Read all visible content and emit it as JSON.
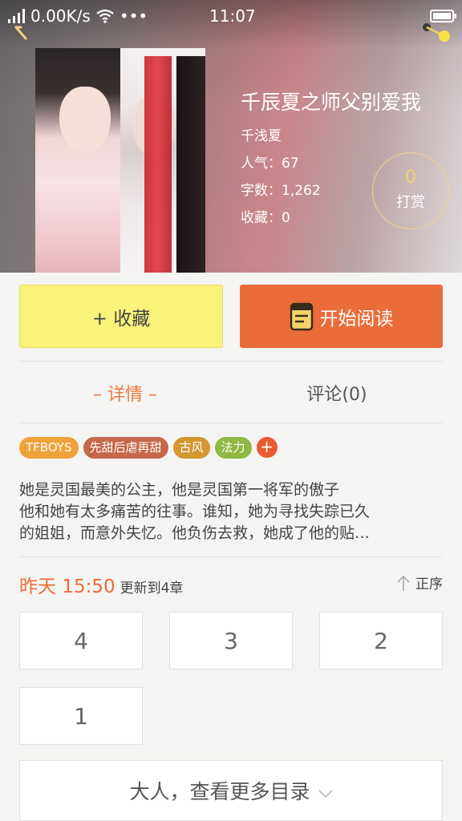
{
  "status_bar": {
    "network_speed": "0.00K/s",
    "more": "•••",
    "time": "11:07"
  },
  "book": {
    "title": "千辰夏之师父别爱我",
    "author": "千浅夏",
    "popularity_label": "人气：",
    "popularity": "67",
    "word_count_label": "字数：",
    "word_count": "1,262",
    "favorites_label": "收藏：",
    "favorites": "0"
  },
  "reward": {
    "count": "0",
    "label": "打赏"
  },
  "actions": {
    "collect_label": "+ 收藏",
    "read_label": "开始阅读"
  },
  "tabs": [
    {
      "label": "– 详情 –",
      "active": true
    },
    {
      "label": "评论(0)",
      "active": false
    }
  ],
  "tags": [
    {
      "label": "TFBOYS",
      "color": "#f0a23a"
    },
    {
      "label": "先甜后虐再甜",
      "color": "#c5674a"
    },
    {
      "label": "古风",
      "color": "#d4962f"
    },
    {
      "label": "法力",
      "color": "#8fb844"
    }
  ],
  "tag_add": "+",
  "description": [
    "她是灵国最美的公主，他是灵国第一将军的傲子",
    "他和她有太多痛苦的往事。谁知，她为寻找失踪已久",
    "的姐姐，而意外失忆。他负伤去救，她成了他的贴…"
  ],
  "update": {
    "time": "昨天 15:50",
    "text": "更新到4章"
  },
  "sort_label": "正序",
  "chapters": [
    "4",
    "3",
    "2",
    "1"
  ],
  "more_label": "大人，查看更多目录",
  "colors": {
    "accent": "#ea6c3b",
    "collect": "#fbf27a",
    "tab_active": "#ea7a3f",
    "reward_num": "#f7d266"
  }
}
